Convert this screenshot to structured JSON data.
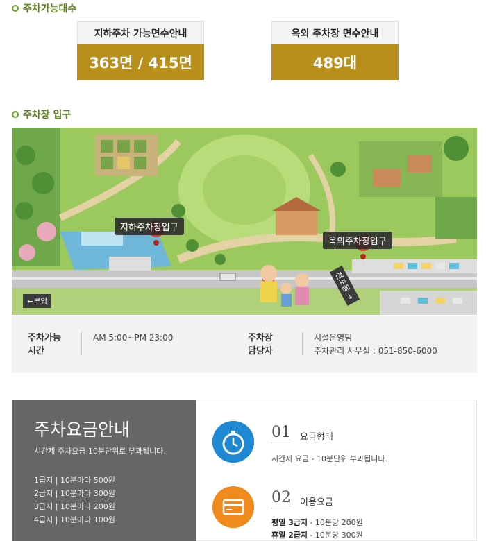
{
  "sections": {
    "capacity_title": "주차가능대수",
    "entrance_title": "주차장 입구"
  },
  "capacity": {
    "underground_label": "지하주차 가능면수안내",
    "underground_value": "363면 / 415면",
    "outdoor_label": "옥외 주차장 면수안내",
    "outdoor_value": "489대"
  },
  "map": {
    "pin_underground": "지하주차장입구",
    "pin_outdoor": "옥외주차장입구",
    "dir_left": "←부암",
    "dir_right": "전포동 →"
  },
  "info": {
    "hours_label_1": "주차가능",
    "hours_label_2": "시간",
    "hours_value": "AM 5:00~PM 23:00",
    "manager_label_1": "주차장",
    "manager_label_2": "담당자",
    "manager_value_1": "시설운영팀",
    "manager_value_2": "주차관리 사무실 : 051-850-6000"
  },
  "fee": {
    "title": "주차요금안내",
    "desc": "시간제 주차요금 10분단위로 부과됩니다.",
    "tiers": [
      "1급지 | 10분마다 500원",
      "2급지 | 10분마다 300원",
      "3급지 | 10분마다 200원",
      "4급지 | 10분마다 100원"
    ],
    "items": [
      {
        "num": "01",
        "title": "요금형태",
        "desc": "시간제 요금 - 10분단위 부과됩니다.",
        "icon": "stopwatch-icon",
        "color": "#1e88d2"
      },
      {
        "num": "02",
        "title": "이용요금",
        "desc_1_bold": "평일 3급지",
        "desc_1_rest": " - 10분당 200원",
        "desc_2_bold": "휴일 2급지",
        "desc_2_rest": " - 10분당 300원",
        "icon": "card-icon",
        "color": "#f08a1c"
      }
    ]
  },
  "colors": {
    "accent_green": "#5b7f1a",
    "gold": "#b98f1c",
    "dark_panel": "#666666"
  }
}
